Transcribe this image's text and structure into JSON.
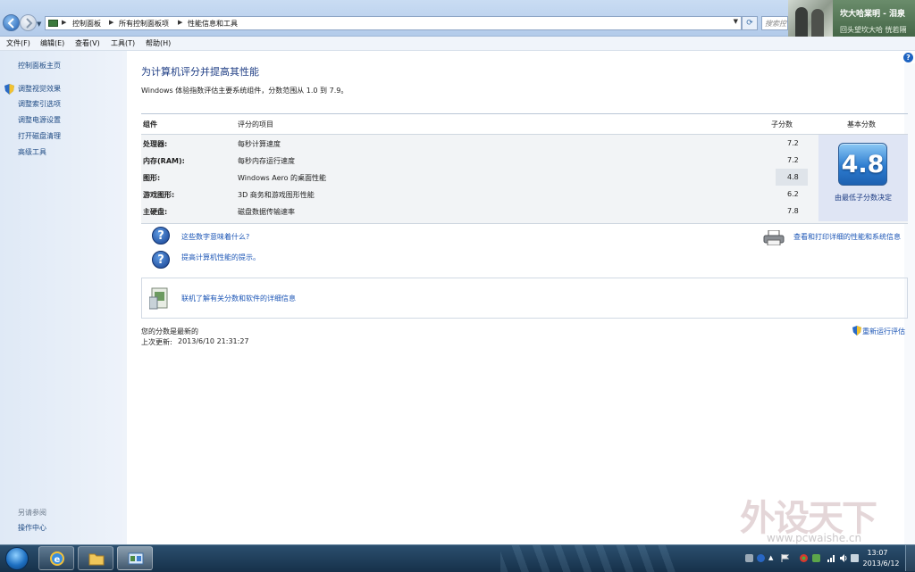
{
  "addressbar": {
    "breadcrumbs": [
      "控制面板",
      "所有控制面板项",
      "性能信息和工具"
    ],
    "search_placeholder": "搜索控"
  },
  "music_popup": {
    "title": "坎大哈棠明 - 泪泉",
    "lyric": "回头望坎大哈 恍若隔"
  },
  "menubar": [
    "文件(F)",
    "编辑(E)",
    "查看(V)",
    "工具(T)",
    "帮助(H)"
  ],
  "sidebar": {
    "home": "控制面板主页",
    "items": [
      "调整视觉效果",
      "调整索引选项",
      "调整电源设置",
      "打开磁盘清理",
      "高级工具"
    ],
    "see_also": "另请参阅",
    "action_center": "操作中心"
  },
  "main": {
    "title": "为计算机评分并提高其性能",
    "subtitle": "Windows 体验指数评估主要系统组件，分数范围从 1.0 到 7.9。",
    "table": {
      "headers": [
        "组件",
        "评分的项目",
        "子分数",
        "基本分数"
      ],
      "rows": [
        {
          "component": "处理器:",
          "item": "每秒计算速度",
          "subscore": "7.2"
        },
        {
          "component": "内存(RAM):",
          "item": "每秒内存运行速度",
          "subscore": "7.2"
        },
        {
          "component": "图形:",
          "item": "Windows Aero 的桌面性能",
          "subscore": "4.8"
        },
        {
          "component": "游戏图形:",
          "item": "3D 商务和游戏图形性能",
          "subscore": "6.2"
        },
        {
          "component": "主硬盘:",
          "item": "磁盘数据传输速率",
          "subscore": "7.8"
        }
      ],
      "base_score": "4.8",
      "base_caption": "由最低子分数决定"
    },
    "links": {
      "what_mean": "这些数字意味着什么?",
      "tips": "提高计算机性能的提示。",
      "print_details": "查看和打印详细的性能和系统信息",
      "online_info": "联机了解有关分数和软件的详细信息",
      "rerun": "重新运行评估"
    },
    "status_latest": "您的分数是最新的",
    "last_update_label": "上次更新:",
    "last_update_value": "2013/6/10 21:31:27"
  },
  "watermark": {
    "text": "外设天下",
    "url": "www.pcwaishe.cn"
  },
  "taskbar": {
    "time": "13:07",
    "date": "2013/6/12"
  }
}
